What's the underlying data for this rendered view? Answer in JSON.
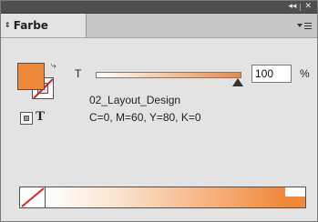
{
  "titlebar": {
    "collapse_glyph": "◂◂",
    "close_glyph": "✕"
  },
  "panel": {
    "title": "Farbe",
    "tab_arrows_icon": "⇕"
  },
  "swatches": {
    "fill_color": "#f0883a",
    "stroke": "none",
    "swap_icon": "⤷",
    "format_text_glyph": "T"
  },
  "tint": {
    "label": "T",
    "value": "100",
    "unit": "%",
    "percent": 100
  },
  "color": {
    "name": "02_Layout_Design",
    "values": "C=0, M=60, Y=80, K=0",
    "hex": "#f0883a"
  },
  "ramp": {
    "end_color": "#f0883a"
  }
}
